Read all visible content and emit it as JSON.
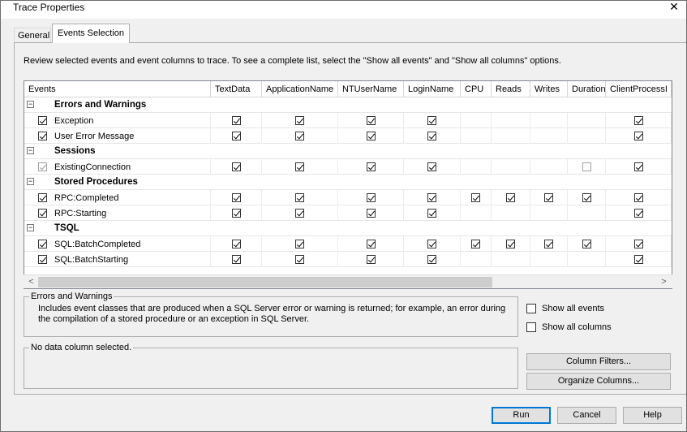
{
  "window": {
    "title": "Trace Properties",
    "close_glyph": "✕"
  },
  "tabs": [
    {
      "label": "General"
    },
    {
      "label": "Events Selection"
    }
  ],
  "description": "Review selected events and event columns to trace. To see a complete list, select the \"Show all events\" and \"Show all columns\" options.",
  "grid": {
    "columns": [
      "Events",
      "TextData",
      "ApplicationName",
      "NTUserName",
      "LoginName",
      "CPU",
      "Reads",
      "Writes",
      "Duration",
      "ClientProcessI"
    ],
    "rows": [
      {
        "type": "category",
        "label": "Errors and Warnings",
        "expander": "−"
      },
      {
        "type": "event",
        "label": "Exception",
        "enabled": true,
        "cells": [
          "on",
          "on",
          "on",
          "on",
          "",
          "",
          "",
          "",
          "on"
        ]
      },
      {
        "type": "event",
        "label": "User Error Message",
        "enabled": true,
        "cells": [
          "on",
          "on",
          "on",
          "on",
          "",
          "",
          "",
          "",
          "on"
        ]
      },
      {
        "type": "category",
        "label": "Sessions",
        "expander": "−"
      },
      {
        "type": "event",
        "label": "ExistingConnection",
        "enabled": false,
        "cells": [
          "on",
          "on",
          "on",
          "on",
          "",
          "",
          "",
          "off",
          "on"
        ]
      },
      {
        "type": "category",
        "label": "Stored Procedures",
        "expander": "−"
      },
      {
        "type": "event",
        "label": "RPC:Completed",
        "enabled": true,
        "cells": [
          "on",
          "on",
          "on",
          "on",
          "on",
          "on",
          "on",
          "on",
          "on"
        ]
      },
      {
        "type": "event",
        "label": "RPC:Starting",
        "enabled": true,
        "cells": [
          "on",
          "on",
          "on",
          "on",
          "",
          "",
          "",
          "",
          "on"
        ]
      },
      {
        "type": "category",
        "label": "TSQL",
        "expander": "−"
      },
      {
        "type": "event",
        "label": "SQL:BatchCompleted",
        "enabled": true,
        "cells": [
          "on",
          "on",
          "on",
          "on",
          "on",
          "on",
          "on",
          "on",
          "on"
        ]
      },
      {
        "type": "event",
        "label": "SQL:BatchStarting",
        "enabled": true,
        "cells": [
          "on",
          "on",
          "on",
          "on",
          "",
          "",
          "",
          "",
          "on"
        ]
      }
    ]
  },
  "scrollbar": {
    "left_arrow": "<",
    "right_arrow": ">"
  },
  "info_group": {
    "title": "Errors and Warnings",
    "text": "Includes event classes that are produced when a SQL Server error or warning is returned; for example, an error during the compilation of a stored procedure or an exception in SQL Server."
  },
  "column_group": {
    "title": "No data column selected."
  },
  "options": {
    "show_all_events": {
      "label": "Show all events",
      "checked": false
    },
    "show_all_columns": {
      "label": "Show all columns",
      "checked": false
    }
  },
  "buttons": {
    "column_filters": "Column Filters...",
    "organize_columns": "Organize Columns...",
    "run": "Run",
    "cancel": "Cancel",
    "help": "Help"
  },
  "colors": {
    "accent": "#0078d7",
    "panel": "#f0f0f0",
    "border": "#adadad"
  }
}
